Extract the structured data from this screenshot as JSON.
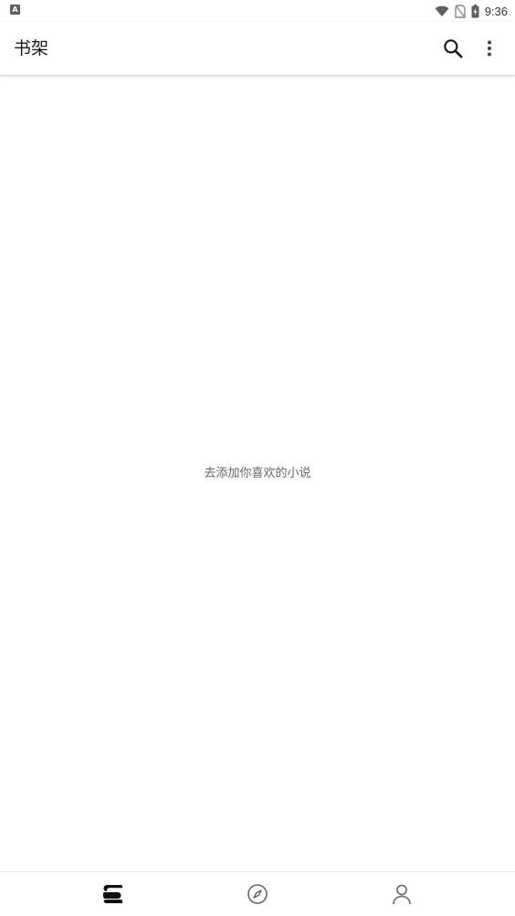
{
  "status_bar": {
    "app_icon": "A",
    "time": "9:36",
    "icons": [
      "wifi-icon",
      "no-sim-icon",
      "battery-charging-icon"
    ]
  },
  "app_bar": {
    "title": "书架",
    "actions": [
      "search-icon",
      "more-vert-icon"
    ]
  },
  "content": {
    "empty_message": "去添加你喜欢的小说"
  },
  "bottom_nav": {
    "items": [
      {
        "icon": "bookshelf-icon",
        "active": true
      },
      {
        "icon": "compass-icon",
        "active": false
      },
      {
        "icon": "person-icon",
        "active": false
      }
    ]
  },
  "colors": {
    "background": "#ffffff",
    "active_icon": "#111111",
    "inactive_icon": "#666666",
    "empty_text": "#666666"
  }
}
